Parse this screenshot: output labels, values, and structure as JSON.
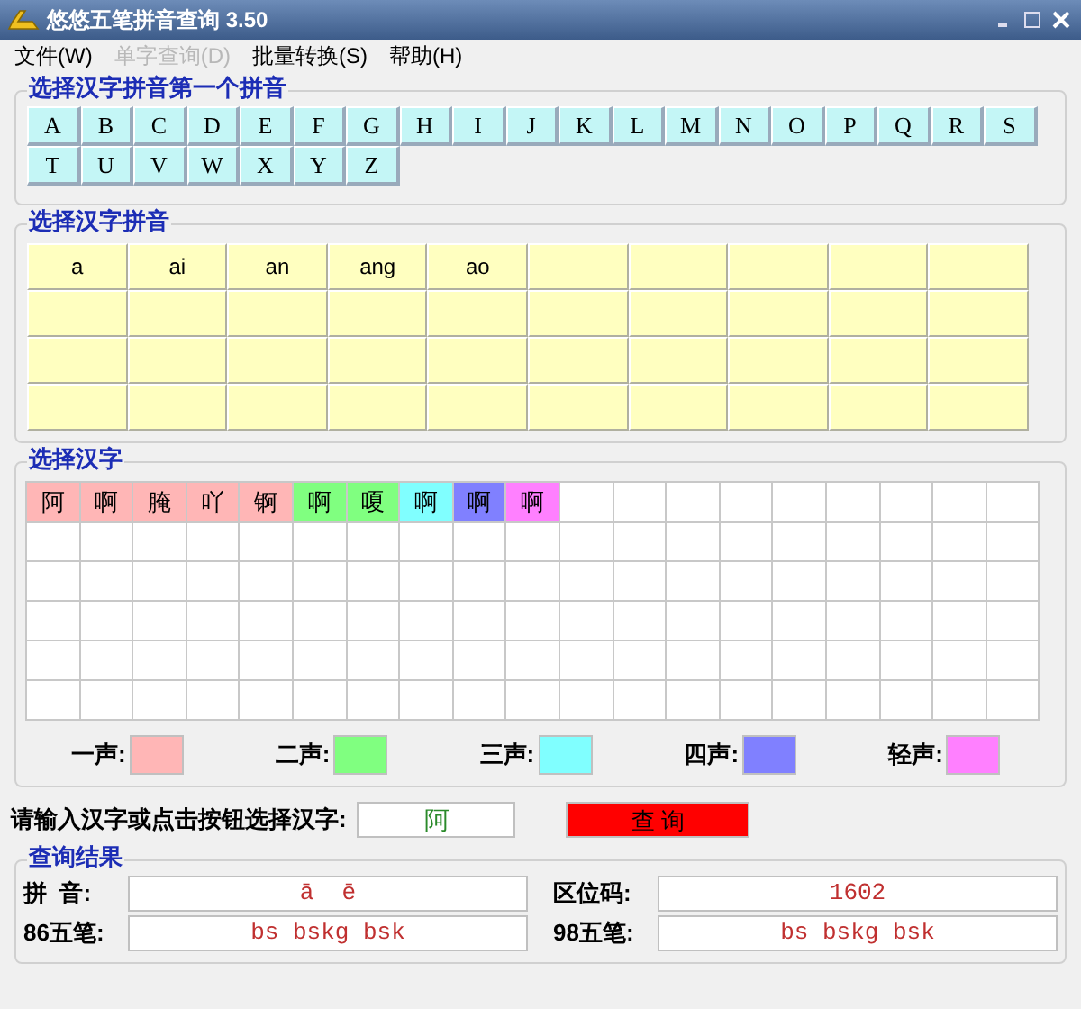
{
  "window": {
    "title": "悠悠五笔拼音查询 3.50"
  },
  "menu": [
    {
      "label": "文件(W)",
      "disabled": false
    },
    {
      "label": "单字查询(D)",
      "disabled": true
    },
    {
      "label": "批量转换(S)",
      "disabled": false
    },
    {
      "label": "帮助(H)",
      "disabled": false
    }
  ],
  "initials": {
    "title": "选择汉字拼音第一个拼音",
    "letters": [
      "A",
      "B",
      "C",
      "D",
      "E",
      "F",
      "G",
      "H",
      "I",
      "J",
      "K",
      "L",
      "M",
      "N",
      "O",
      "P",
      "Q",
      "R",
      "S",
      "T",
      "U",
      "V",
      "W",
      "X",
      "Y",
      "Z"
    ]
  },
  "syllables": {
    "title": "选择汉字拼音",
    "items": [
      "a",
      "ai",
      "an",
      "ang",
      "ao"
    ]
  },
  "characters": {
    "title": "选择汉字",
    "items": [
      {
        "char": "阿",
        "color": "#ffb6b6"
      },
      {
        "char": "啊",
        "color": "#ffb6b6"
      },
      {
        "char": "腌",
        "color": "#ffb6b6"
      },
      {
        "char": "吖",
        "color": "#ffb6b6"
      },
      {
        "char": "锕",
        "color": "#ffb6b6"
      },
      {
        "char": "啊",
        "color": "#80ff80"
      },
      {
        "char": "嗄",
        "color": "#80ff80"
      },
      {
        "char": "啊",
        "color": "#80ffff"
      },
      {
        "char": "啊",
        "color": "#8080ff"
      },
      {
        "char": "啊",
        "color": "#ff80ff"
      }
    ]
  },
  "legend": [
    {
      "label": "一声:",
      "color": "#ffb6b6"
    },
    {
      "label": "二声:",
      "color": "#80ff80"
    },
    {
      "label": "三声:",
      "color": "#80ffff"
    },
    {
      "label": "四声:",
      "color": "#8080ff"
    },
    {
      "label": "轻声:",
      "color": "#ff80ff"
    }
  ],
  "input": {
    "label": "请输入汉字或点击按钮选择汉字:",
    "value": "阿",
    "button": "查 询"
  },
  "results": {
    "title": "查询结果",
    "fields": [
      {
        "label": "拼  音:",
        "value": "ā  ē"
      },
      {
        "label": "区位码:",
        "value": "1602"
      },
      {
        "label": "86五笔:",
        "value": "bs bskg bsk"
      },
      {
        "label": "98五笔:",
        "value": "bs bskg bsk"
      }
    ]
  }
}
